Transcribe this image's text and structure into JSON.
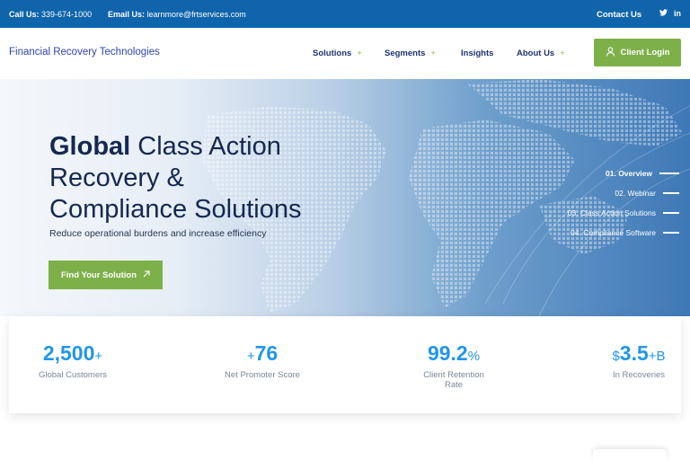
{
  "topbar": {
    "call_label": "Call Us:",
    "call_value": "339-674-1000",
    "email_label": "Email Us:",
    "email_value": "learnmore@frtservices.com",
    "contact_label": "Contact Us",
    "social": [
      "twitter-icon",
      "linkedin-icon"
    ]
  },
  "nav": {
    "brand": "Financial Recovery Technologies",
    "items": [
      {
        "label": "Solutions",
        "has_submenu": true
      },
      {
        "label": "Segments",
        "has_submenu": true
      },
      {
        "label": "Insights",
        "has_submenu": false
      },
      {
        "label": "About Us",
        "has_submenu": true
      }
    ],
    "submenu_marker": "+",
    "login_label": "Client Login"
  },
  "hero": {
    "title_bold": "Global",
    "title_line1_rest": " Class Action",
    "title_line2": "Recovery &",
    "title_line3": "Compliance Solutions",
    "subtitle": "Reduce operational burdens and increase efficiency",
    "cta_label": "Find Your Solution",
    "steps": [
      {
        "label": "01. Overview",
        "active": true
      },
      {
        "label": "02. Webinar",
        "active": false
      },
      {
        "label": "03. Class Action Solutions",
        "active": false
      },
      {
        "label": "04. Compliance Software",
        "active": false
      }
    ]
  },
  "stats": [
    {
      "prefix": "",
      "value": "2,500",
      "suffix": "+",
      "label": "Global Customers"
    },
    {
      "prefix": "+",
      "value": "76",
      "suffix": "",
      "label": "Net Promoter Score"
    },
    {
      "prefix": "",
      "value": "99.2",
      "suffix": "%",
      "label": "Client Retention Rate"
    },
    {
      "prefix": "$",
      "value": "3.5",
      "suffix": "+B",
      "label": "In Recoveries"
    }
  ],
  "colors": {
    "topbar": "#0f64ab",
    "brand_text": "#2f43b5",
    "accent_green": "#7eb04a",
    "stat_blue": "#2196e8",
    "heading_dark": "#15284f"
  }
}
